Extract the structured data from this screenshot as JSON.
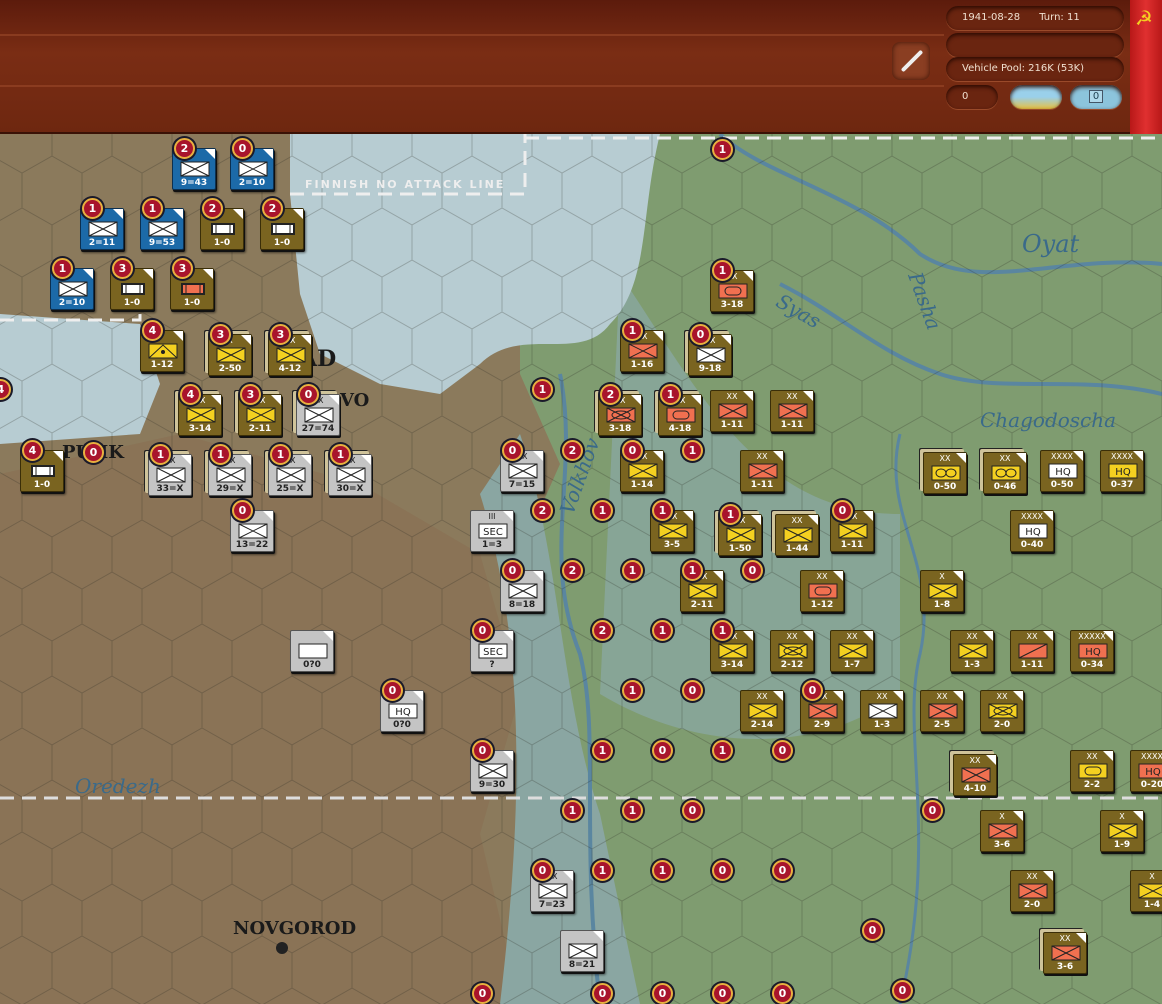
{
  "header": {
    "date": "1941-08-28",
    "turn": "Turn: 11",
    "status_line": "",
    "vehicle_pool": "Vehicle Pool: 216K (53K)",
    "counter_value": "0",
    "weather": "clear-summer",
    "toggle_value": "0"
  },
  "colors": {
    "soviet": "#7a6420",
    "finnish": "#1c6aa8",
    "german": "#c4c4c4",
    "flag": "#d02020"
  },
  "map_labels": {
    "finnish_line": "FINNISH NO ATTACK LINE",
    "leningrad": "AD",
    "kolpino": "VO",
    "pushkin": "PUHK",
    "novgorod": "NOVGOROD",
    "volkhov": "Volkhov",
    "syas": "Syas",
    "pasha": "Pasha",
    "oyat": "Oyat",
    "chagodoscha": "Chagodoscha",
    "oredezh": "Oredezh"
  },
  "counters": [
    {
      "label": "9=43",
      "echelon": "",
      "symbol": "inf",
      "side": "fin",
      "fill": "#fff",
      "badge": "2"
    },
    {
      "label": "2=10",
      "echelon": "",
      "symbol": "inf",
      "side": "fin",
      "fill": "#fff",
      "badge": "0"
    },
    {
      "label": "2=11",
      "echelon": "",
      "symbol": "inf",
      "side": "fin",
      "fill": "#fff",
      "badge": "1"
    },
    {
      "label": "9=53",
      "echelon": "",
      "symbol": "inf",
      "side": "fin",
      "fill": "#fff",
      "badge": "1"
    },
    {
      "label": "2=10",
      "echelon": "",
      "symbol": "inf",
      "side": "fin",
      "fill": "#fff",
      "badge": "1"
    },
    {
      "label": "1-0",
      "echelon": "",
      "symbol": "fort",
      "side": "sov",
      "fill": "#fff",
      "badge": "2"
    },
    {
      "label": "1-0",
      "echelon": "",
      "symbol": "fort",
      "side": "sov",
      "fill": "#fff",
      "badge": "2"
    },
    {
      "label": "1-0",
      "echelon": "",
      "symbol": "fort",
      "side": "sov",
      "fill": "#fff",
      "badge": "3"
    },
    {
      "label": "1-0",
      "echelon": "",
      "symbol": "fort",
      "side": "sov",
      "fill": "#f07050",
      "badge": "3"
    },
    {
      "label": "1-12",
      "echelon": "",
      "symbol": "art",
      "side": "sov",
      "fill": "#f4d020",
      "badge": "4"
    },
    {
      "label": "2-50",
      "echelon": "X",
      "symbol": "inf",
      "side": "sov",
      "fill": "#f4d020",
      "badge": "3",
      "stack": true
    },
    {
      "label": "4-12",
      "echelon": "XX",
      "symbol": "inf",
      "side": "sov",
      "fill": "#f4d020",
      "badge": "3",
      "stack": true
    },
    {
      "label": "3-14",
      "echelon": "XX",
      "symbol": "inf",
      "side": "sov",
      "fill": "#f4d020",
      "badge": "4",
      "stack": true
    },
    {
      "label": "2-11",
      "echelon": "XX",
      "symbol": "inf",
      "side": "sov",
      "fill": "#f4d020",
      "badge": "3",
      "stack": true
    },
    {
      "label": "27=74",
      "echelon": "XX",
      "symbol": "inf",
      "side": "ger",
      "fill": "#fff",
      "badge": "0",
      "stack": true
    },
    {
      "label": "1-0",
      "echelon": "",
      "symbol": "fort",
      "side": "sov",
      "fill": "#fff",
      "badge": "4"
    },
    {
      "label": "33=X",
      "echelon": "XX",
      "symbol": "inf",
      "side": "ger",
      "fill": "#fff",
      "badge": "1",
      "stack": true
    },
    {
      "label": "29=X",
      "echelon": "XX",
      "symbol": "inf",
      "side": "ger",
      "fill": "#fff",
      "badge": "1",
      "stack": true
    },
    {
      "label": "25=X",
      "echelon": "XX",
      "symbol": "inf",
      "side": "ger",
      "fill": "#fff",
      "badge": "1",
      "stack": true
    },
    {
      "label": "30=X",
      "echelon": "XX",
      "symbol": "inf",
      "side": "ger",
      "fill": "#fff",
      "badge": "1",
      "stack": true
    },
    {
      "label": "13=22",
      "echelon": "",
      "symbol": "inf",
      "side": "ger",
      "fill": "#fff",
      "badge": "0"
    },
    {
      "label": "1=3",
      "echelon": "III",
      "symbol": "SEC",
      "side": "ger",
      "fill": "#fff",
      "badge": ""
    },
    {
      "label": "7=15",
      "echelon": "XX",
      "symbol": "inf",
      "side": "ger",
      "fill": "#fff",
      "badge": "0"
    },
    {
      "label": "8=18",
      "echelon": "",
      "symbol": "inf",
      "side": "ger",
      "fill": "#fff",
      "badge": "0"
    },
    {
      "label": "0?0",
      "echelon": "",
      "symbol": "empty",
      "side": "ger",
      "fill": "#fff",
      "badge": ""
    },
    {
      "label": "?",
      "echelon": "",
      "symbol": "SEC",
      "side": "ger",
      "fill": "#fff",
      "badge": "0"
    },
    {
      "label": "0?0",
      "echelon": "",
      "symbol": "HQ",
      "side": "ger",
      "fill": "#fff",
      "badge": "0"
    },
    {
      "label": "9=30",
      "echelon": "",
      "symbol": "inf",
      "side": "ger",
      "fill": "#fff",
      "badge": "0"
    },
    {
      "label": "7=23",
      "echelon": "XX",
      "symbol": "inf",
      "side": "ger",
      "fill": "#fff",
      "badge": "0"
    },
    {
      "label": "8=21",
      "echelon": "",
      "symbol": "inf",
      "side": "ger",
      "fill": "#fff",
      "badge": ""
    },
    {
      "label": "3-18",
      "echelon": "XX",
      "symbol": "arm",
      "side": "sov",
      "fill": "#f07050",
      "badge": "1"
    },
    {
      "label": "1-16",
      "echelon": "XX",
      "symbol": "inf",
      "side": "sov",
      "fill": "#f07050",
      "badge": "1"
    },
    {
      "label": "9-18",
      "echelon": "XX",
      "symbol": "inf",
      "side": "sov",
      "fill": "#fff",
      "badge": "0",
      "stack": true
    },
    {
      "label": "3-18",
      "echelon": "XX",
      "symbol": "mech",
      "side": "sov",
      "fill": "#f07050",
      "badge": "2",
      "stack": true
    },
    {
      "label": "4-18",
      "echelon": "XX",
      "symbol": "arm",
      "side": "sov",
      "fill": "#f07050",
      "badge": "1",
      "stack": true
    },
    {
      "label": "1-11",
      "echelon": "XX",
      "symbol": "inf",
      "side": "sov",
      "fill": "#f07050",
      "badge": ""
    },
    {
      "label": "1-11",
      "echelon": "XX",
      "symbol": "inf",
      "side": "sov",
      "fill": "#f07050",
      "badge": ""
    },
    {
      "label": "1-14",
      "echelon": "XX",
      "symbol": "inf",
      "side": "sov",
      "fill": "#f4d020",
      "badge": "0"
    },
    {
      "label": "1-11",
      "echelon": "XX",
      "symbol": "inf",
      "side": "sov",
      "fill": "#f07050",
      "badge": ""
    },
    {
      "label": "3-5",
      "echelon": "XX",
      "symbol": "inf",
      "side": "sov",
      "fill": "#f4d020",
      "badge": "1"
    },
    {
      "label": "1-50",
      "echelon": "XX",
      "symbol": "inf",
      "side": "sov",
      "fill": "#f4d020",
      "badge": "1",
      "stack": true
    },
    {
      "label": "1-44",
      "echelon": "XX",
      "symbol": "inf",
      "side": "sov",
      "fill": "#f4d020",
      "badge": "",
      "stack": true
    },
    {
      "label": "1-11",
      "echelon": "XX",
      "symbol": "inf",
      "side": "sov",
      "fill": "#f4d020",
      "badge": "0"
    },
    {
      "label": "2-11",
      "echelon": "XX",
      "symbol": "inf",
      "side": "sov",
      "fill": "#f4d020",
      "badge": "1"
    },
    {
      "label": "1-12",
      "echelon": "XX",
      "symbol": "arm",
      "side": "sov",
      "fill": "#f07050",
      "badge": ""
    },
    {
      "label": "0-50",
      "echelon": "XX",
      "symbol": "fortline",
      "side": "sov",
      "fill": "#f4d020",
      "badge": "",
      "stack": true
    },
    {
      "label": "0-46",
      "echelon": "XX",
      "symbol": "fortline",
      "side": "sov",
      "fill": "#f4d020",
      "badge": "",
      "stack": true
    },
    {
      "label": "0-50",
      "echelon": "XXXX",
      "symbol": "HQ",
      "side": "sov",
      "fill": "#fff",
      "badge": ""
    },
    {
      "label": "0-37",
      "echelon": "XXXX",
      "symbol": "HQ",
      "side": "sov",
      "fill": "#f4d020",
      "badge": ""
    },
    {
      "label": "0-40",
      "echelon": "XXXX",
      "symbol": "HQ",
      "side": "sov",
      "fill": "#fff",
      "badge": ""
    },
    {
      "label": "1-8",
      "echelon": "X",
      "symbol": "inf",
      "side": "sov",
      "fill": "#f4d020",
      "badge": ""
    },
    {
      "label": "3-14",
      "echelon": "XX",
      "symbol": "inf",
      "side": "sov",
      "fill": "#f4d020",
      "badge": "1"
    },
    {
      "label": "2-12",
      "echelon": "XX",
      "symbol": "mech",
      "side": "sov",
      "fill": "#f4d020",
      "badge": ""
    },
    {
      "label": "1-7",
      "echelon": "XX",
      "symbol": "inf",
      "side": "sov",
      "fill": "#f4d020",
      "badge": ""
    },
    {
      "label": "1-3",
      "echelon": "XX",
      "symbol": "inf",
      "side": "sov",
      "fill": "#f4d020",
      "badge": ""
    },
    {
      "label": "1-11",
      "echelon": "XX",
      "symbol": "cav",
      "side": "sov",
      "fill": "#f07050",
      "badge": ""
    },
    {
      "label": "0-34",
      "echelon": "XXXXX",
      "symbol": "HQ",
      "side": "sov",
      "fill": "#f07050",
      "badge": ""
    },
    {
      "label": "2-14",
      "echelon": "XX",
      "symbol": "inf",
      "side": "sov",
      "fill": "#f4d020",
      "badge": ""
    },
    {
      "label": "2-9",
      "echelon": "XX",
      "symbol": "inf",
      "side": "sov",
      "fill": "#f07050",
      "badge": "0"
    },
    {
      "label": "1-3",
      "echelon": "XX",
      "symbol": "inf",
      "side": "sov",
      "fill": "#fff",
      "badge": ""
    },
    {
      "label": "2-5",
      "echelon": "XX",
      "symbol": "inf",
      "side": "sov",
      "fill": "#f07050",
      "badge": ""
    },
    {
      "label": "2-0",
      "echelon": "XX",
      "symbol": "mech",
      "side": "sov",
      "fill": "#f4d020",
      "badge": ""
    },
    {
      "label": "4-10",
      "echelon": "XX",
      "symbol": "inf",
      "side": "sov",
      "fill": "#f07050",
      "badge": "",
      "stack": true
    },
    {
      "label": "2-2",
      "echelon": "XX",
      "symbol": "arm",
      "side": "sov",
      "fill": "#f4d020",
      "badge": ""
    },
    {
      "label": "0-20",
      "echelon": "XXXX",
      "symbol": "HQ",
      "side": "sov",
      "fill": "#f07050",
      "badge": ""
    },
    {
      "label": "3-6",
      "echelon": "X",
      "symbol": "inf",
      "side": "sov",
      "fill": "#f07050",
      "badge": ""
    },
    {
      "label": "1-9",
      "echelon": "X",
      "symbol": "inf",
      "side": "sov",
      "fill": "#f4d020",
      "badge": ""
    },
    {
      "label": "2-0",
      "echelon": "XX",
      "symbol": "inf",
      "side": "sov",
      "fill": "#f07050",
      "badge": ""
    },
    {
      "label": "1-4",
      "echelon": "X",
      "symbol": "inf",
      "side": "sov",
      "fill": "#f4d020",
      "badge": ""
    },
    {
      "label": "3-6",
      "echelon": "XX",
      "symbol": "inf",
      "side": "sov",
      "fill": "#f07050",
      "badge": "",
      "stack": true
    }
  ],
  "zoc_markers": [
    "1",
    "1",
    "4",
    "0",
    "2",
    "1",
    "2",
    "1",
    "1",
    "2",
    "0",
    "2",
    "1",
    "1",
    "0",
    "1",
    "0",
    "1",
    "0",
    "1",
    "1",
    "0",
    "0",
    "1",
    "1",
    "0",
    "0",
    "0",
    "0",
    "0",
    "0",
    "0",
    "0",
    "0"
  ]
}
